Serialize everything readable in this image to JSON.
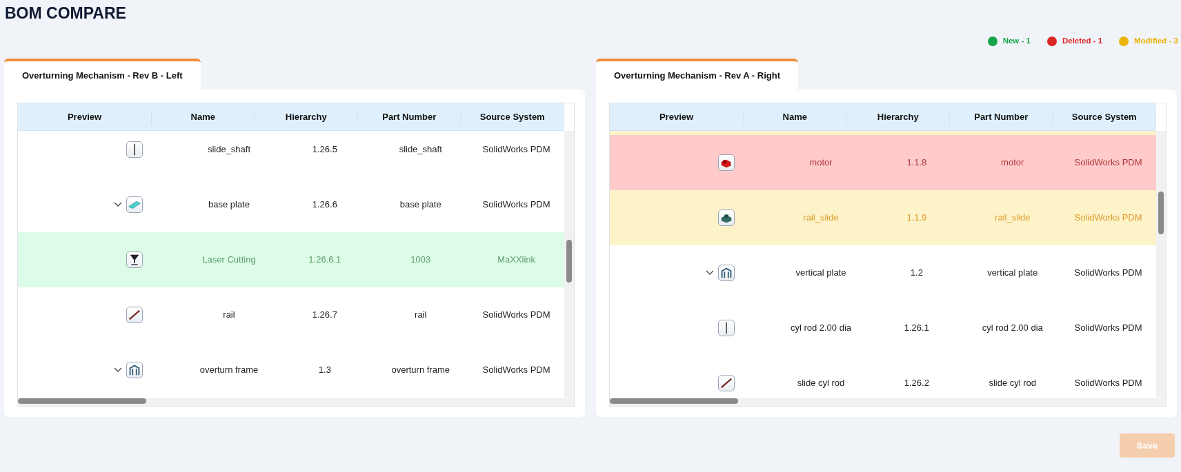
{
  "title": "BOM COMPARE",
  "legend": [
    {
      "label": "New - 1",
      "color": "#16a34a"
    },
    {
      "label": "Deleted - 1",
      "color": "#dc2626"
    },
    {
      "label": "Modified - 3",
      "color": "#eab308"
    }
  ],
  "panels": [
    {
      "tab": {
        "label": "Overturning Mechanism - Rev B - Left",
        "selected": true
      },
      "columns": [
        "Preview",
        "Name",
        "Hierarchy",
        "Part Number",
        "Source System"
      ],
      "rows": [
        {
          "added": false,
          "deleted": false,
          "modified": false,
          "expandable": false,
          "kind": "rod",
          "cells": [
            "",
            "slide_shaft",
            "1.26.5",
            "slide_shaft",
            "SolidWorks PDM"
          ]
        },
        {
          "added": false,
          "deleted": false,
          "modified": false,
          "expandable": true,
          "kind": "plate",
          "cells": [
            "",
            "base plate",
            "1.26.6",
            "base plate",
            "SolidWorks PDM"
          ]
        },
        {
          "added": true,
          "deleted": false,
          "modified": false,
          "expandable": false,
          "kind": "laser",
          "cells": [
            "",
            "Laser Cutting",
            "1.26.6.1",
            "1003",
            "MaXXlink"
          ]
        },
        {
          "added": false,
          "deleted": false,
          "modified": false,
          "expandable": false,
          "kind": "rail",
          "cells": [
            "",
            "rail",
            "1.26.7",
            "rail",
            "SolidWorks PDM"
          ]
        },
        {
          "added": false,
          "deleted": false,
          "modified": false,
          "expandable": true,
          "kind": "frame",
          "cells": [
            "",
            "overturn frame",
            "1.3",
            "overturn frame",
            "SolidWorks PDM"
          ]
        }
      ]
    },
    {
      "tab": {
        "label": "Overturning Mechanism - Rev A - Right",
        "selected": true
      },
      "columns": [
        "Preview",
        "Name",
        "Hierarchy",
        "Part Number",
        "Source System"
      ],
      "rows": [
        {
          "added": false,
          "deleted": false,
          "modified": true
        },
        {
          "added": false,
          "deleted": true,
          "modified": false,
          "expandable": false,
          "kind": "motor",
          "cells": [
            "",
            "motor",
            "1.1.8",
            "motor",
            "SolidWorks PDM"
          ]
        },
        {
          "added": false,
          "deleted": false,
          "modified": true,
          "expandable": false,
          "kind": "block",
          "cells": [
            "",
            "rail_slide",
            "1.1.9",
            "rail_slide",
            "SolidWorks PDM"
          ]
        },
        {
          "added": false,
          "deleted": false,
          "modified": false,
          "expandable": true,
          "kind": "frame",
          "cells": [
            "",
            "vertical plate",
            "1.2",
            "vertical plate",
            "SolidWorks PDM"
          ]
        },
        {
          "added": false,
          "deleted": false,
          "modified": false,
          "expandable": false,
          "kind": "rod",
          "cells": [
            "",
            "cyl rod 2.00 dia",
            "1.26.1",
            "cyl rod 2.00 dia",
            "SolidWorks PDM"
          ]
        },
        {
          "added": false,
          "deleted": false,
          "modified": false,
          "expandable": false,
          "kind": "rail",
          "cells": [
            "",
            "slide cyl rod",
            "1.26.2",
            "slide cyl rod",
            "SolidWorks PDM"
          ]
        }
      ]
    }
  ],
  "save_button": {
    "label": "Save",
    "disabled": true
  }
}
